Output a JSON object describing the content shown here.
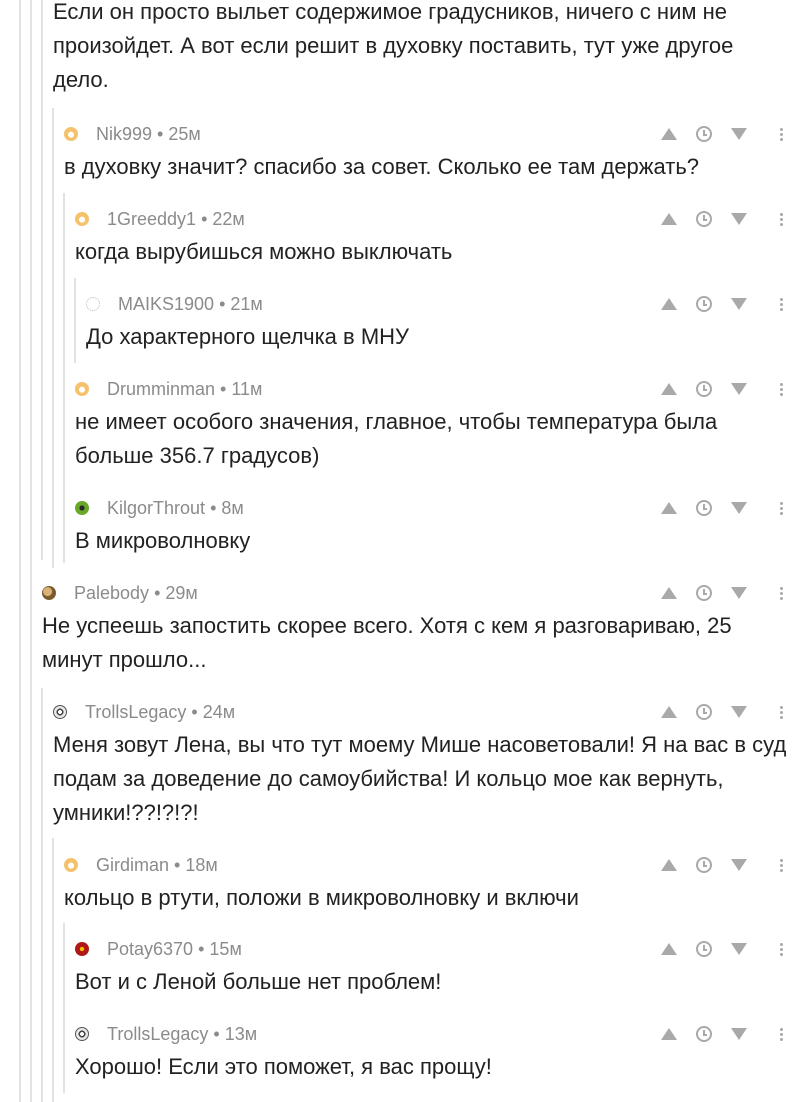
{
  "comments": [
    {
      "author": "",
      "time": "",
      "avatar": "",
      "text": "Если он просто выльет содержимое градусников, ничего с ним не произойдет. А вот если решит  в духовку поставить, тут уже другое дело."
    },
    {
      "author": "Nik999",
      "time": "25м",
      "avatar": "default",
      "text": "в духовку значит? спасибо за совет. Сколько ее там держать?"
    },
    {
      "author": "1Greeddy1",
      "time": "22м",
      "avatar": "default",
      "text": "когда вырубишься можно выключать"
    },
    {
      "author": "MAIKS1900",
      "time": "21м",
      "avatar": "dots",
      "text": "До характерного щелчка в МНУ"
    },
    {
      "author": "Drumminman",
      "time": "11м",
      "avatar": "default",
      "text": "не имеет особого значения, главное, чтобы температура была больше 356.7 градусов)"
    },
    {
      "author": "KilgorThrout",
      "time": "8м",
      "avatar": "green",
      "text": "В микроволновку"
    },
    {
      "author": "Palebody",
      "time": "29м",
      "avatar": "dog",
      "text": "Не успеешь запостить скорее всего. Хотя с кем я разговариваю, 25 минут прошло..."
    },
    {
      "author": "TrollsLegacy",
      "time": "24м",
      "avatar": "troll",
      "text": "Меня зовут Лена, вы что тут моему Мише насоветовали! Я на вас в суд подам за доведение до самоубийства! И кольцо мое как вернуть, умники!??!?!?!"
    },
    {
      "author": "Girdiman",
      "time": "18м",
      "avatar": "default",
      "text": "кольцо в ртути, положи в микроволновку и включи"
    },
    {
      "author": "Potay6370",
      "time": "15м",
      "avatar": "red",
      "text": "Вот и с Леной больше нет проблем!"
    },
    {
      "author": "TrollsLegacy",
      "time": "13м",
      "avatar": "troll",
      "text": "Хорошо! Если это поможет, я вас прощу!"
    }
  ],
  "separator": "•"
}
